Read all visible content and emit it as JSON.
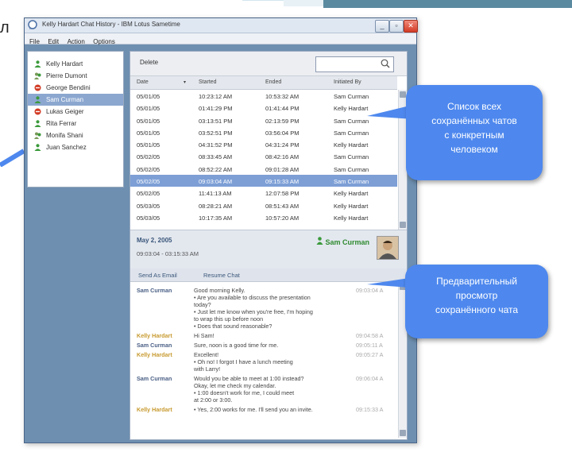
{
  "window": {
    "title": "Kelly Hardart Chat History - IBM Lotus Sametime"
  },
  "menu": [
    "File",
    "Edit",
    "Action",
    "Options"
  ],
  "contacts": [
    {
      "name": "Kelly Hardart",
      "status": "available"
    },
    {
      "name": "Pierre Dumont",
      "status": "multi"
    },
    {
      "name": "George Bendini",
      "status": "dnd"
    },
    {
      "name": "Sam Curman",
      "status": "available",
      "selected": true
    },
    {
      "name": "Lukas Geiger",
      "status": "dnd"
    },
    {
      "name": "Rita Ferrar",
      "status": "available"
    },
    {
      "name": "Monifa Shani",
      "status": "multi"
    },
    {
      "name": "Juan Sanchez",
      "status": "available"
    }
  ],
  "toolbar": {
    "delete_label": "Delete",
    "search_value": ""
  },
  "table": {
    "columns": [
      "Date",
      "Started",
      "Ended",
      "Initiated By"
    ],
    "rows": [
      [
        "05/01/05",
        "10:23:12 AM",
        "10:53:32 AM",
        "Sam Curman"
      ],
      [
        "05/01/05",
        "01:41:29 PM",
        "01:41:44 PM",
        "Kelly Hardart"
      ],
      [
        "05/01/05",
        "03:13:51 PM",
        "02:13:59 PM",
        "Sam Curman"
      ],
      [
        "05/01/05",
        "03:52:51 PM",
        "03:56:04 PM",
        "Sam Curman"
      ],
      [
        "05/01/05",
        "04:31:52 PM",
        "04:31:24 PM",
        "Kelly Hardart"
      ],
      [
        "05/02/05",
        "08:33:45 AM",
        "08:42:16 AM",
        "Sam Curman"
      ],
      [
        "05/02/05",
        "08:52:22 AM",
        "09:01:28 AM",
        "Sam Curman"
      ],
      [
        "05/02/05",
        "09:03:04 AM",
        "09:15:33 AM",
        "Sam Curman"
      ],
      [
        "05/02/05",
        "11:41:13 AM",
        "12:07:58 PM",
        "Kelly Hardart"
      ],
      [
        "05/03/05",
        "08:28:21 AM",
        "08:51:43 AM",
        "Kelly Hardart"
      ],
      [
        "05/03/05",
        "10:17:35 AM",
        "10:57:20 AM",
        "Kelly Hardart"
      ]
    ],
    "selected_index": 7
  },
  "preview": {
    "date": "May 2, 2005",
    "time_range": "09:03:04 - 03:15:33 AM",
    "participant": "Sam Curman"
  },
  "actions": {
    "send_email": "Send As Email",
    "resume_chat": "Resume Chat"
  },
  "chat": [
    {
      "speaker": "Sam Curman",
      "who": "sam",
      "lines": [
        "Good morning Kelly.",
        "• Are you available to discuss the presentation",
        "  today?",
        "• Just let me know when you're free, I'm hoping",
        "  to wrap this up before noon",
        "• Does that sound reasonable?"
      ],
      "time": "09:03:04 A"
    },
    {
      "speaker": "Kelly Hardart",
      "who": "kelly",
      "lines": [
        "Hi Sam!"
      ],
      "time": "09:04:58 A"
    },
    {
      "speaker": "Sam Curman",
      "who": "sam",
      "lines": [
        "Sure, noon is a good time for me."
      ],
      "time": "09:05:11 A"
    },
    {
      "speaker": "Kelly Hardart",
      "who": "kelly",
      "lines": [
        "Excellent!",
        "• Oh no! I forgot I have a lunch meeting",
        "  with Larry!"
      ],
      "time": "09:05:27 A"
    },
    {
      "speaker": "Sam Curman",
      "who": "sam",
      "lines": [
        "Would you be able to meet at 1:00 instead?",
        "Okay, let me check my calendar.",
        "• 1:00 doesn't work for me, I could meet",
        "  at 2:00 or 3:00."
      ],
      "time": "09:06:04 A"
    },
    {
      "speaker": "Kelly Hardart",
      "who": "kelly",
      "lines": [
        "• Yes, 2:00 works for me. I'll send you an invite."
      ],
      "time": "09:15:33 A"
    }
  ],
  "callouts": {
    "list": [
      "Список всех",
      "сохранённых чатов",
      "с конкретным",
      "человеком"
    ],
    "preview": [
      "Предварительный",
      "просмотр",
      "сохранённого чата"
    ]
  },
  "page_mark": "л",
  "colors": {
    "callout": "#4e88ee",
    "selection": "#7d9fd6",
    "window_bg": "#6e8fb0"
  }
}
